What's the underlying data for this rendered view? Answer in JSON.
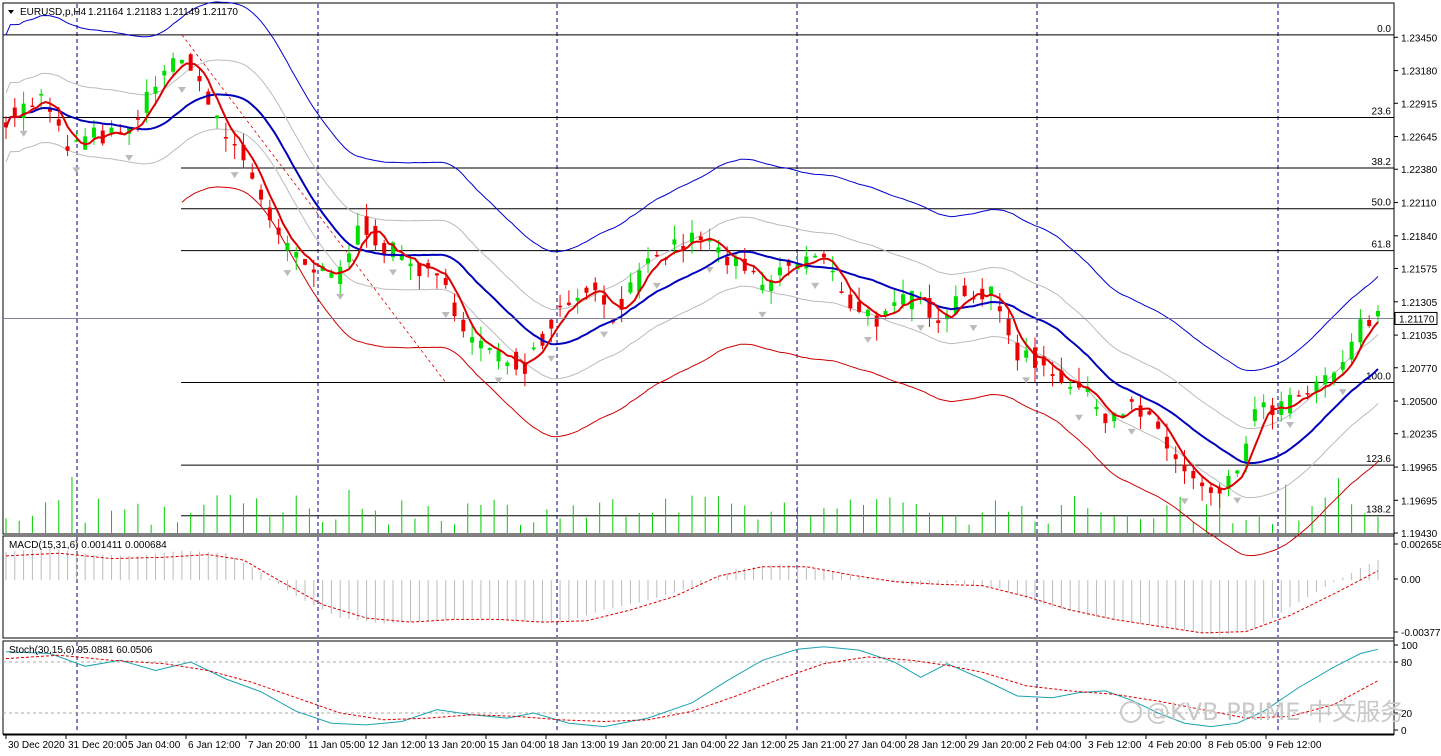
{
  "header": {
    "symbol": "EURUSD,p,H4",
    "ohlc": "1.21164 1.21183 1.21149 1.21170"
  },
  "colors": {
    "bull": "#00dd00",
    "bear": "#ee0000",
    "ma_fast": "#dd0000",
    "ma_slow": "#0000bb",
    "band_inner": "#bbbbbb",
    "band_outer_high": "#0000cc",
    "band_outer_low": "#cc0000",
    "volume": "#00cc00",
    "grid": "#000080",
    "current_price_box": "#ffffff"
  },
  "chart_data": [
    {
      "type": "candlestick",
      "panel": "price",
      "title": "EURUSD,p,H4",
      "price_axis_ticks": [
        "1.23450",
        "1.23180",
        "1.22915",
        "1.22645",
        "1.22380",
        "1.22110",
        "1.21840",
        "1.21575",
        "1.21305",
        "1.21035",
        "1.20770",
        "1.20500",
        "1.20235",
        "1.19965",
        "1.19695",
        "1.19430"
      ],
      "ylim": [
        1.1943,
        1.2372
      ],
      "current_price": "1.21170",
      "time_axis_labels": [
        "30 Dec 2020",
        "31 Dec 20:00",
        "5 Jan 04:00",
        "6 Jan 12:00",
        "7 Jan 20:00",
        "11 Jan 05:00",
        "12 Jan 12:00",
        "13 Jan 20:00",
        "15 Jan 04:00",
        "18 Jan 13:00",
        "19 Jan 20:00",
        "21 Jan 04:00",
        "22 Jan 12:00",
        "25 Jan 21:00",
        "27 Jan 04:00",
        "28 Jan 12:00",
        "29 Jan 20:00",
        "2 Feb 04:00",
        "3 Feb 12:00",
        "4 Feb 20:00",
        "8 Feb 05:00",
        "9 Feb 12:00"
      ],
      "fibonacci_levels": [
        {
          "label": "0.0",
          "price": 1.2347
        },
        {
          "label": "23.6",
          "price": 1.228
        },
        {
          "label": "38.2",
          "price": 1.2239
        },
        {
          "label": "50.0",
          "price": 1.2206
        },
        {
          "label": "61.8",
          "price": 1.2172
        },
        {
          "label": "100.0",
          "price": 1.2065
        },
        {
          "label": "123.6",
          "price": 1.1998
        },
        {
          "label": "138.2",
          "price": 1.1957
        }
      ],
      "close_path": [
        {
          "bar": 0,
          "close": 1.228
        },
        {
          "bar": 8,
          "close": 1.2295
        },
        {
          "bar": 14,
          "close": 1.2255
        },
        {
          "bar": 20,
          "close": 1.2265
        },
        {
          "bar": 28,
          "close": 1.2265
        },
        {
          "bar": 35,
          "close": 1.2318
        },
        {
          "bar": 42,
          "close": 1.2325
        },
        {
          "bar": 48,
          "close": 1.2275
        },
        {
          "bar": 55,
          "close": 1.224
        },
        {
          "bar": 63,
          "close": 1.2175
        },
        {
          "bar": 69,
          "close": 1.2155
        },
        {
          "bar": 75,
          "close": 1.215
        },
        {
          "bar": 81,
          "close": 1.2195
        },
        {
          "bar": 86,
          "close": 1.2175
        },
        {
          "bar": 93,
          "close": 1.216
        },
        {
          "bar": 100,
          "close": 1.214
        },
        {
          "bar": 106,
          "close": 1.21
        },
        {
          "bar": 112,
          "close": 1.2085
        },
        {
          "bar": 118,
          "close": 1.208
        },
        {
          "bar": 126,
          "close": 1.2125
        },
        {
          "bar": 132,
          "close": 1.2145
        },
        {
          "bar": 138,
          "close": 1.212
        },
        {
          "bar": 145,
          "close": 1.2155
        },
        {
          "bar": 152,
          "close": 1.2175
        },
        {
          "bar": 158,
          "close": 1.2183
        },
        {
          "bar": 164,
          "close": 1.2165
        },
        {
          "bar": 172,
          "close": 1.2142
        },
        {
          "bar": 178,
          "close": 1.216
        },
        {
          "bar": 185,
          "close": 1.2168
        },
        {
          "bar": 192,
          "close": 1.213
        },
        {
          "bar": 199,
          "close": 1.2115
        },
        {
          "bar": 206,
          "close": 1.2135
        },
        {
          "bar": 212,
          "close": 1.212
        },
        {
          "bar": 218,
          "close": 1.214
        },
        {
          "bar": 224,
          "close": 1.2135
        },
        {
          "bar": 230,
          "close": 1.209
        },
        {
          "bar": 238,
          "close": 1.2075
        },
        {
          "bar": 244,
          "close": 1.206
        },
        {
          "bar": 250,
          "close": 1.204
        },
        {
          "bar": 256,
          "close": 1.2045
        },
        {
          "bar": 262,
          "close": 1.2025
        },
        {
          "bar": 268,
          "close": 1.1992
        },
        {
          "bar": 274,
          "close": 1.197
        },
        {
          "bar": 279,
          "close": 1.1985
        },
        {
          "bar": 284,
          "close": 1.204
        },
        {
          "bar": 290,
          "close": 1.2045
        },
        {
          "bar": 296,
          "close": 1.2055
        },
        {
          "bar": 302,
          "close": 1.207
        },
        {
          "bar": 308,
          "close": 1.211
        },
        {
          "bar": 312,
          "close": 1.2117
        }
      ]
    },
    {
      "type": "histogram",
      "panel": "macd",
      "title": "MACD(15,31,6) 0.001411 0.000684",
      "axis_ticks": [
        "0.002658",
        "0.00",
        "-0.003775"
      ],
      "ylim": [
        -0.0042,
        0.0032
      ],
      "series": [
        {
          "name": "MACD",
          "points": [
            [
              0,
              0.0021
            ],
            [
              10,
              0.0024
            ],
            [
              20,
              0.0019
            ],
            [
              30,
              0.0018
            ],
            [
              40,
              0.0022
            ],
            [
              50,
              0.002
            ],
            [
              58,
              0.0006
            ],
            [
              66,
              -0.0012
            ],
            [
              76,
              -0.0028
            ],
            [
              86,
              -0.0032
            ],
            [
              96,
              -0.003
            ],
            [
              106,
              -0.0028
            ],
            [
              116,
              -0.003
            ],
            [
              126,
              -0.0032
            ],
            [
              136,
              -0.0022
            ],
            [
              146,
              -0.0015
            ],
            [
              156,
              -0.0005
            ],
            [
              166,
              0.0008
            ],
            [
              176,
              0.0012
            ],
            [
              186,
              0.0008
            ],
            [
              196,
              0.0002
            ],
            [
              206,
              -0.0004
            ],
            [
              216,
              -0.0002
            ],
            [
              226,
              -0.0006
            ],
            [
              236,
              -0.0018
            ],
            [
              246,
              -0.0026
            ],
            [
              256,
              -0.0031
            ],
            [
              266,
              -0.0036
            ],
            [
              276,
              -0.0041
            ],
            [
              284,
              -0.0036
            ],
            [
              292,
              -0.002
            ],
            [
              300,
              -0.0005
            ],
            [
              308,
              0.0009
            ],
            [
              312,
              0.0015
            ]
          ]
        },
        {
          "name": "Signal",
          "points": [
            [
              0,
              0.0018
            ],
            [
              12,
              0.002
            ],
            [
              24,
              0.0016
            ],
            [
              36,
              0.0017
            ],
            [
              46,
              0.0019
            ],
            [
              54,
              0.0015
            ],
            [
              62,
              0.0
            ],
            [
              72,
              -0.0018
            ],
            [
              82,
              -0.0028
            ],
            [
              92,
              -0.0031
            ],
            [
              102,
              -0.0029
            ],
            [
              112,
              -0.0029
            ],
            [
              122,
              -0.0031
            ],
            [
              132,
              -0.003
            ],
            [
              142,
              -0.0022
            ],
            [
              152,
              -0.0012
            ],
            [
              162,
              0.0003
            ],
            [
              172,
              0.001
            ],
            [
              182,
              0.001
            ],
            [
              192,
              0.0004
            ],
            [
              202,
              -0.0001
            ],
            [
              212,
              -0.0003
            ],
            [
              222,
              -0.0004
            ],
            [
              232,
              -0.0012
            ],
            [
              242,
              -0.0022
            ],
            [
              252,
              -0.0029
            ],
            [
              262,
              -0.0034
            ],
            [
              272,
              -0.0039
            ],
            [
              282,
              -0.0038
            ],
            [
              292,
              -0.0026
            ],
            [
              302,
              -0.001
            ],
            [
              312,
              0.0007
            ]
          ]
        }
      ]
    },
    {
      "type": "line",
      "panel": "stochastic",
      "title": "Stoch(30,15,6) 95.0881 60.0506",
      "axis_ticks": [
        "100",
        "80",
        "20",
        "0"
      ],
      "ylim": [
        0,
        100
      ],
      "series": [
        {
          "name": "%K",
          "points": [
            [
              0,
              92
            ],
            [
              10,
              90
            ],
            [
              18,
              75
            ],
            [
              26,
              82
            ],
            [
              34,
              70
            ],
            [
              42,
              80
            ],
            [
              50,
              60
            ],
            [
              58,
              45
            ],
            [
              66,
              22
            ],
            [
              74,
              8
            ],
            [
              82,
              6
            ],
            [
              90,
              10
            ],
            [
              98,
              24
            ],
            [
              106,
              18
            ],
            [
              114,
              14
            ],
            [
              120,
              20
            ],
            [
              128,
              8
            ],
            [
              136,
              4
            ],
            [
              146,
              14
            ],
            [
              156,
              32
            ],
            [
              164,
              58
            ],
            [
              172,
              82
            ],
            [
              180,
              95
            ],
            [
              186,
              98
            ],
            [
              194,
              94
            ],
            [
              202,
              80
            ],
            [
              208,
              62
            ],
            [
              214,
              78
            ],
            [
              222,
              60
            ],
            [
              230,
              40
            ],
            [
              238,
              38
            ],
            [
              244,
              44
            ],
            [
              250,
              46
            ],
            [
              256,
              35
            ],
            [
              262,
              20
            ],
            [
              268,
              8
            ],
            [
              274,
              4
            ],
            [
              280,
              8
            ],
            [
              286,
              22
            ],
            [
              294,
              50
            ],
            [
              302,
              74
            ],
            [
              308,
              90
            ],
            [
              312,
              95
            ]
          ]
        },
        {
          "name": "%D",
          "points": [
            [
              0,
              84
            ],
            [
              12,
              88
            ],
            [
              24,
              82
            ],
            [
              36,
              78
            ],
            [
              46,
              70
            ],
            [
              56,
              56
            ],
            [
              66,
              38
            ],
            [
              76,
              20
            ],
            [
              86,
              12
            ],
            [
              96,
              14
            ],
            [
              106,
              18
            ],
            [
              116,
              16
            ],
            [
              126,
              12
            ],
            [
              136,
              10
            ],
            [
              146,
              12
            ],
            [
              156,
              22
            ],
            [
              166,
              40
            ],
            [
              176,
              60
            ],
            [
              186,
              78
            ],
            [
              196,
              86
            ],
            [
              206,
              82
            ],
            [
              214,
              76
            ],
            [
              222,
              68
            ],
            [
              232,
              52
            ],
            [
              242,
              46
            ],
            [
              252,
              42
            ],
            [
              262,
              34
            ],
            [
              272,
              24
            ],
            [
              282,
              14
            ],
            [
              292,
              16
            ],
            [
              302,
              30
            ],
            [
              312,
              58
            ]
          ]
        }
      ],
      "reference_lines": [
        80,
        20
      ]
    }
  ],
  "watermark": {
    "text": "@KVB PRIME 中文服务"
  }
}
